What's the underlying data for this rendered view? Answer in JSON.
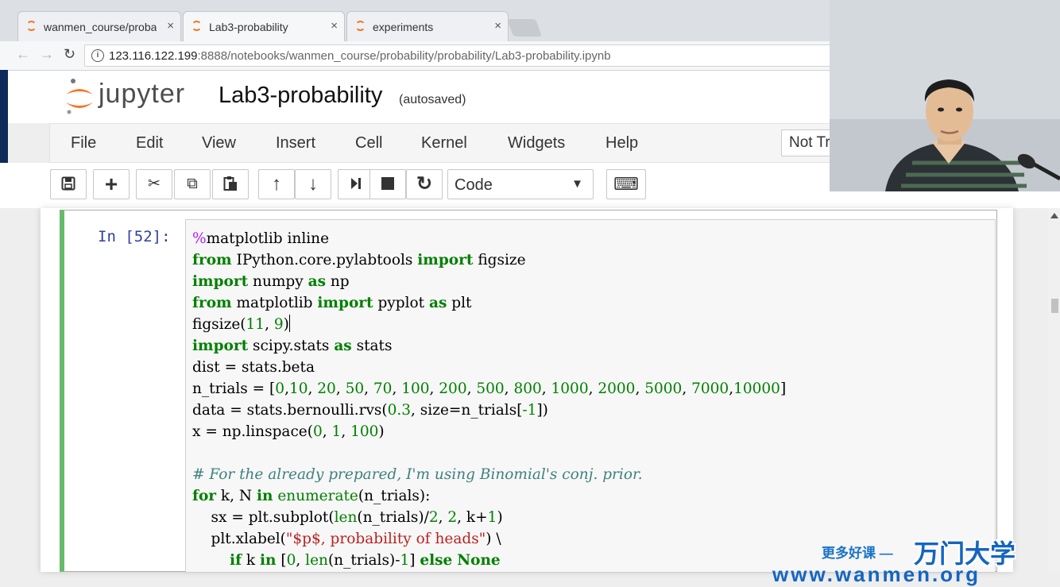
{
  "browser": {
    "tabs": [
      {
        "label": "wanmen_course/proba",
        "close": "×",
        "active": false
      },
      {
        "label": "Lab3-probability",
        "close": "×",
        "active": true
      },
      {
        "label": "experiments",
        "close": "×",
        "active": false
      }
    ],
    "back": "←",
    "forward": "→",
    "reload": "↻",
    "url_host": "123.116.122.199",
    "url_rest": ":8888/notebooks/wanmen_course/probability/probability/Lab3-probability.ipynb"
  },
  "jupyter": {
    "logo_text": "jupyter",
    "notebook_title": "Lab3-probability",
    "autosave": "(autosaved)",
    "menu": [
      "File",
      "Edit",
      "View",
      "Insert",
      "Cell",
      "Kernel",
      "Widgets",
      "Help"
    ],
    "trust_label": "Not Trusted",
    "toolbar": {
      "save": "💾",
      "add": "+",
      "cut": "✂",
      "copy": "⧉",
      "paste": "📋",
      "up": "↑",
      "down": "↓",
      "run": "⏭",
      "stop": "■",
      "restart": "↻",
      "cell_type": "Code",
      "caret": "▼",
      "keyboard": "⌨"
    }
  },
  "cell": {
    "prompt": "In  [52]:"
  },
  "watermark": {
    "small": "更多好课 —",
    "big": "万门大学",
    "url": "www.wanmen.org"
  },
  "colors": {
    "cell_border": "#66bb6a",
    "jupyter_orange": "#f37726",
    "keyword_green": "#008000",
    "string_red": "#ba2121",
    "comment_teal": "#408080"
  }
}
